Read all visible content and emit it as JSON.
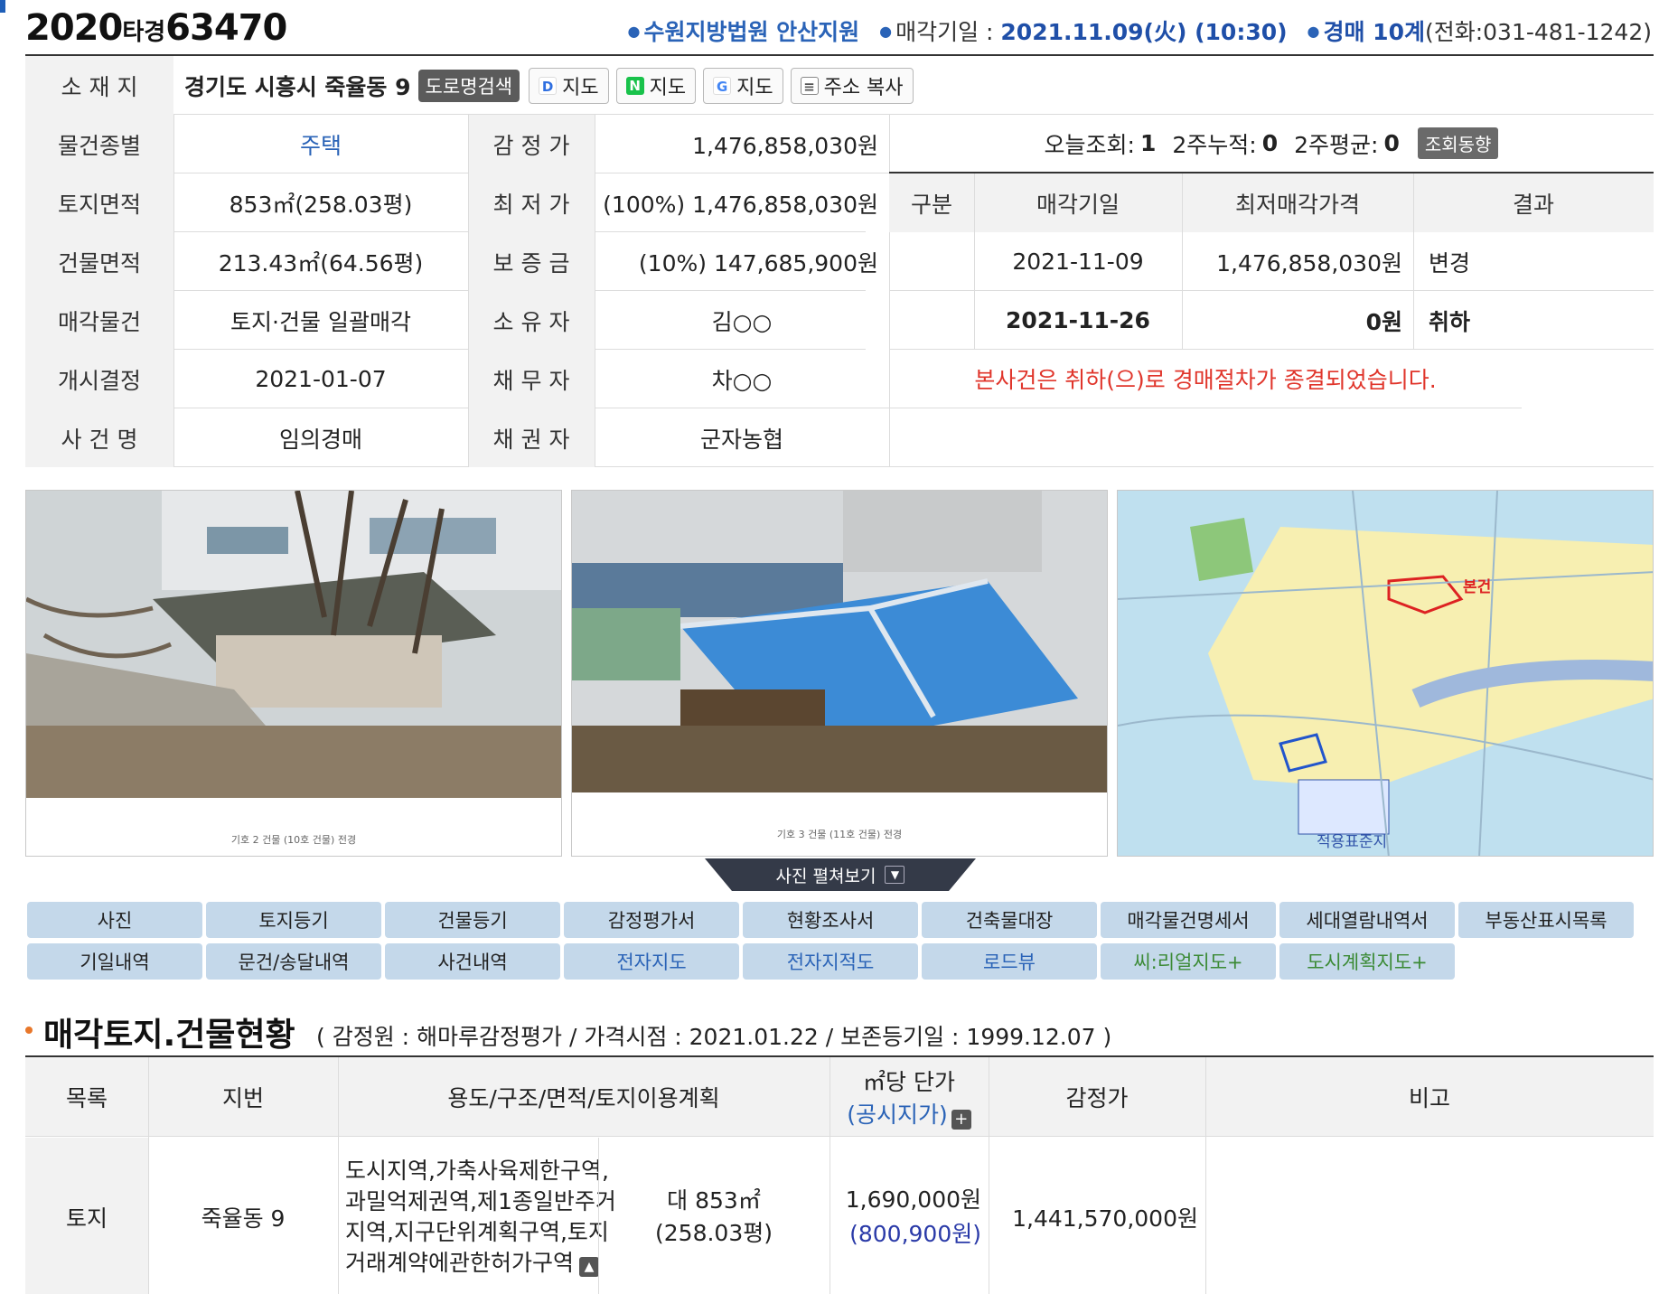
{
  "header": {
    "case_year": "2020",
    "case_kind": "타경",
    "case_number": "63470",
    "court": "수원지방법원 안산지원",
    "sale_date_label": "매각기일 : ",
    "sale_date": "2021.11.09(火) (10:30)",
    "dept": "경매 10계",
    "phone": "(전화:031-481-1242)"
  },
  "info": {
    "address_label": "소 재 지",
    "address": "경기도 시흥시 죽율동 9",
    "road_search": "도로명검색",
    "map_daum": "지도",
    "map_naver": "지도",
    "map_google": "지도",
    "copy_address": "주소 복사",
    "rows": [
      {
        "label": "물건종별",
        "value": "주택",
        "label2": "감 정 가",
        "value2": "1,476,858,030원"
      },
      {
        "label": "토지면적",
        "value": "853㎡(258.03평)",
        "label2": "최 저 가",
        "value2": "(100%) 1,476,858,030원"
      },
      {
        "label": "건물면적",
        "value": "213.43㎡(64.56평)",
        "label2": "보 증 금",
        "value2": "(10%) 147,685,900원"
      },
      {
        "label": "매각물건",
        "value": "토지·건물 일괄매각",
        "label2": "소 유 자",
        "value2": "김○○"
      },
      {
        "label": "개시결정",
        "value": "2021-01-07",
        "label2": "채 무 자",
        "value2": "차○○"
      },
      {
        "label": "사 건 명",
        "value": "임의경매",
        "label2": "채 권 자",
        "value2": "군자농협"
      }
    ],
    "views": {
      "today_label": "오늘조회:",
      "today": "1",
      "two_week_label": "2주누적:",
      "two_week": "0",
      "avg_label": "2주평균:",
      "avg": "0",
      "trend_btn": "조회동향"
    },
    "history_headers": [
      "구분",
      "매각기일",
      "최저매각가격",
      "결과"
    ],
    "history": [
      {
        "kind": "",
        "date": "2021-11-09",
        "price": "1,476,858,030원",
        "result": "변경"
      },
      {
        "kind": "",
        "date": "2021-11-26",
        "price": "0원",
        "result": "취하"
      }
    ],
    "notice": "본사건은 취하(으)로 경매절차가 종결되었습니다."
  },
  "photos": {
    "caption1": "기호 2 건물 (10호 건물) 전경",
    "caption2": "기호 3 건물 (11호 건물) 전경",
    "map_text": "본건",
    "map_bottom": "적용표준지",
    "expand_label": "사진 펼쳐보기"
  },
  "doc_buttons": {
    "row1": [
      "사진",
      "토지등기",
      "건물등기",
      "감정평가서",
      "현황조사서",
      "건축물대장",
      "매각물건명세서",
      "세대열람내역서",
      "부동산표시목록"
    ],
    "row2": [
      "기일내역",
      "문건/송달내역",
      "사건내역",
      "전자지도",
      "전자지적도",
      "로드뷰",
      "씨:리얼지도+",
      "도시계획지도+"
    ]
  },
  "section": {
    "title": "매각토지.건물현황",
    "meta": "( 감정원 : 해마루감정평가 / 가격시점 : 2021.01.22 / 보존등기일 : 1999.12.07 )"
  },
  "land_table": {
    "headers": {
      "list": "목록",
      "lot": "지번",
      "use": "용도/구조/면적/토지이용계획",
      "unit_price": "㎡당 단가",
      "public_price": "(공시지가)",
      "appraisal": "감정가",
      "note": "비고"
    },
    "row": {
      "list": "토지",
      "lot": "죽율동 9",
      "use_lines": [
        "도시지역,가축사육제한구역,",
        "과밀억제권역,제1종일반주거",
        "지역,지구단위계획구역,토지",
        "거래계약에관한허가구역"
      ],
      "area1": "대 853㎡",
      "area2": "(258.03평)",
      "unit_price": "1,690,000원",
      "public_price": "(800,900원)",
      "appraisal": "1,441,570,000원",
      "note": ""
    }
  },
  "colors": {
    "accent_blue": "#2a63b7",
    "alert_red": "#e0352b",
    "button_bg": "#c4d8ea",
    "bullet_orange": "#e8772a"
  }
}
